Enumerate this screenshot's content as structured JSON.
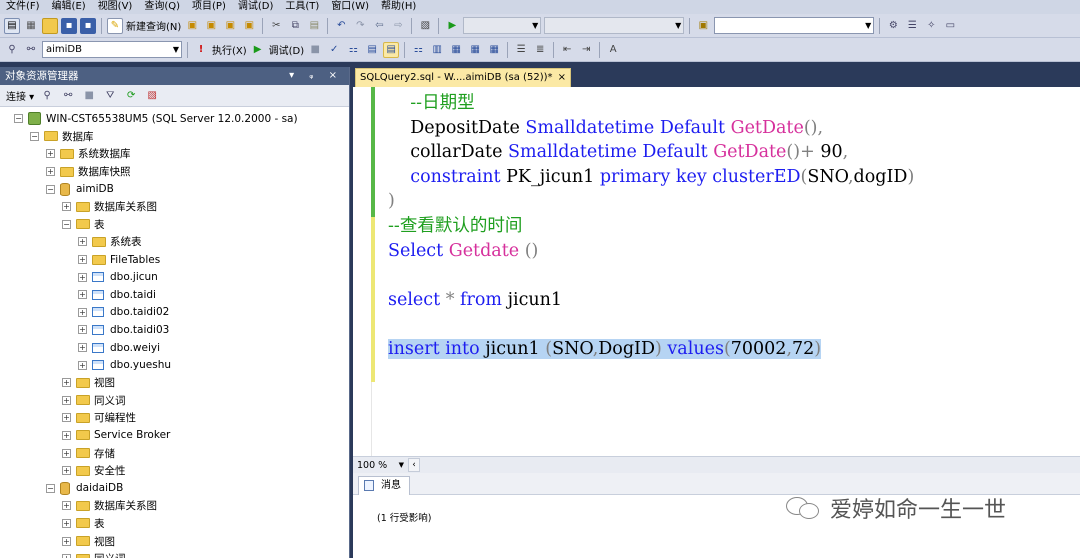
{
  "menu": [
    "文件(F)",
    "编辑(E)",
    "视图(V)",
    "查询(Q)",
    "项目(P)",
    "调试(D)",
    "工具(T)",
    "窗口(W)",
    "帮助(H)"
  ],
  "toolbar1": {
    "new_query_label": "新建查询(N)"
  },
  "toolbar2": {
    "database": "aimiDB",
    "execute_label": "执行(X)",
    "debug_label": "调试(D)"
  },
  "object_explorer": {
    "title": "对象资源管理器",
    "title_controls": "▾ ᵩ ×",
    "connect_label": "连接 ▾",
    "nodes": [
      {
        "level": 0,
        "exp": "⊟",
        "icon": "server",
        "label": "WIN-CST65538UM5 (SQL Server 12.0.2000 - sa)"
      },
      {
        "level": 1,
        "exp": "⊟",
        "icon": "folder",
        "label": "数据库"
      },
      {
        "level": 2,
        "exp": "⊞",
        "icon": "folder",
        "label": "系统数据库"
      },
      {
        "level": 2,
        "exp": "⊞",
        "icon": "folder",
        "label": "数据库快照"
      },
      {
        "level": 2,
        "exp": "⊟",
        "icon": "db",
        "label": "aimiDB"
      },
      {
        "level": 3,
        "exp": "⊞",
        "icon": "folder",
        "label": "数据库关系图"
      },
      {
        "level": 3,
        "exp": "⊟",
        "icon": "folder",
        "label": "表"
      },
      {
        "level": 4,
        "exp": "⊞",
        "icon": "folder",
        "label": "系统表"
      },
      {
        "level": 4,
        "exp": "⊞",
        "icon": "folder",
        "label": "FileTables"
      },
      {
        "level": 4,
        "exp": "⊞",
        "icon": "table",
        "label": "dbo.jicun"
      },
      {
        "level": 4,
        "exp": "⊞",
        "icon": "table",
        "label": "dbo.taidi"
      },
      {
        "level": 4,
        "exp": "⊞",
        "icon": "table",
        "label": "dbo.taidi02"
      },
      {
        "level": 4,
        "exp": "⊞",
        "icon": "table",
        "label": "dbo.taidi03"
      },
      {
        "level": 4,
        "exp": "⊞",
        "icon": "table",
        "label": "dbo.weiyi"
      },
      {
        "level": 4,
        "exp": "⊞",
        "icon": "table",
        "label": "dbo.yueshu"
      },
      {
        "level": 3,
        "exp": "⊞",
        "icon": "folder",
        "label": "视图"
      },
      {
        "level": 3,
        "exp": "⊞",
        "icon": "folder",
        "label": "同义词"
      },
      {
        "level": 3,
        "exp": "⊞",
        "icon": "folder",
        "label": "可编程性"
      },
      {
        "level": 3,
        "exp": "⊞",
        "icon": "folder",
        "label": "Service Broker"
      },
      {
        "level": 3,
        "exp": "⊞",
        "icon": "folder",
        "label": "存储"
      },
      {
        "level": 3,
        "exp": "⊞",
        "icon": "folder",
        "label": "安全性"
      },
      {
        "level": 2,
        "exp": "⊟",
        "icon": "db",
        "label": "daidaiDB"
      },
      {
        "level": 3,
        "exp": "⊞",
        "icon": "folder",
        "label": "数据库关系图"
      },
      {
        "level": 3,
        "exp": "⊞",
        "icon": "folder",
        "label": "表"
      },
      {
        "level": 3,
        "exp": "⊞",
        "icon": "folder",
        "label": "视图"
      },
      {
        "level": 3,
        "exp": "⊞",
        "icon": "folder",
        "label": "同义词"
      }
    ]
  },
  "editor": {
    "tab_title": "SQLQuery2.sql - W....aimiDB (sa (52))*",
    "tab_close": "×",
    "zoom": "100 %",
    "lines": [
      [
        {
          "t": "    --日期型",
          "c": "cm"
        }
      ],
      [
        {
          "t": "    DepositDate ",
          "c": ""
        },
        {
          "t": "Smalldatetime",
          "c": "kw"
        },
        {
          "t": " ",
          "c": ""
        },
        {
          "t": "Default",
          "c": "kw"
        },
        {
          "t": " ",
          "c": ""
        },
        {
          "t": "GetDate",
          "c": "fn"
        },
        {
          "t": "(),",
          "c": "gy"
        }
      ],
      [
        {
          "t": "    collarDate ",
          "c": ""
        },
        {
          "t": "Smalldatetime",
          "c": "kw"
        },
        {
          "t": " ",
          "c": ""
        },
        {
          "t": "Default",
          "c": "kw"
        },
        {
          "t": " ",
          "c": ""
        },
        {
          "t": "GetDate",
          "c": "fn"
        },
        {
          "t": "()+",
          "c": "gy"
        },
        {
          "t": " 90",
          "c": ""
        },
        {
          "t": ",",
          "c": "gy"
        }
      ],
      [
        {
          "t": "    ",
          "c": ""
        },
        {
          "t": "constraint",
          "c": "kw"
        },
        {
          "t": " PK_jicun1 ",
          "c": ""
        },
        {
          "t": "primary",
          "c": "kw"
        },
        {
          "t": " ",
          "c": ""
        },
        {
          "t": "key",
          "c": "kw"
        },
        {
          "t": " ",
          "c": ""
        },
        {
          "t": "clusterED",
          "c": "kw"
        },
        {
          "t": "(",
          "c": "gy"
        },
        {
          "t": "SNO",
          "c": ""
        },
        {
          "t": ",",
          "c": "gy"
        },
        {
          "t": "dogID",
          "c": ""
        },
        {
          "t": ")",
          "c": "gy"
        }
      ],
      [
        {
          "t": ")",
          "c": "gy"
        }
      ],
      [
        {
          "t": "--查看默认的时间",
          "c": "cm"
        }
      ],
      [
        {
          "t": "Select",
          "c": "kw"
        },
        {
          "t": " ",
          "c": ""
        },
        {
          "t": "Getdate",
          "c": "fn"
        },
        {
          "t": " ()",
          "c": "gy"
        }
      ],
      [
        {
          "t": "",
          "c": ""
        }
      ],
      [
        {
          "t": "select",
          "c": "kw"
        },
        {
          "t": " * ",
          "c": "gy"
        },
        {
          "t": "from",
          "c": "kw"
        },
        {
          "t": " jicun1",
          "c": ""
        }
      ],
      [
        {
          "t": "",
          "c": ""
        }
      ],
      [
        {
          "t": "insert",
          "c": "kw sel"
        },
        {
          "t": " ",
          "c": "sel"
        },
        {
          "t": "into",
          "c": "kw sel"
        },
        {
          "t": " jicun1 ",
          "c": "sel"
        },
        {
          "t": "(",
          "c": "gy sel"
        },
        {
          "t": "SNO",
          "c": "sel"
        },
        {
          "t": ",",
          "c": "gy sel"
        },
        {
          "t": "DogID",
          "c": "sel"
        },
        {
          "t": ")",
          "c": "gy sel"
        },
        {
          "t": " ",
          "c": "sel"
        },
        {
          "t": "values",
          "c": "kw sel"
        },
        {
          "t": "(",
          "c": "gy sel"
        },
        {
          "t": "70002",
          "c": "sel"
        },
        {
          "t": ",",
          "c": "gy sel"
        },
        {
          "t": "72",
          "c": "sel"
        },
        {
          "t": ")",
          "c": "gy sel"
        }
      ]
    ]
  },
  "results": {
    "tab_label": "消息",
    "message": "(1 行受影响)"
  },
  "watermark": "爱婷如命一生一世"
}
